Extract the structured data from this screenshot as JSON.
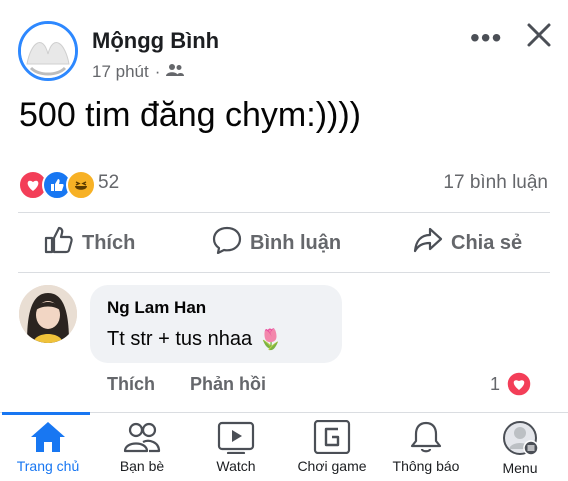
{
  "post": {
    "author": "Mộngg Bình",
    "time": "17 phút",
    "separator": "·",
    "text": "500 tim đăng chym:))))",
    "reaction_count": "52",
    "comment_count": "17 bình luận",
    "more_icon": "more-horizontal-icon",
    "close_icon": "close-icon"
  },
  "actions": {
    "like": "Thích",
    "comment": "Bình luận",
    "share": "Chia sẻ"
  },
  "comment": {
    "name": "Ng Lam Han",
    "text": "Tt str + tus nhaa",
    "emoji": "🌷",
    "like": "Thích",
    "reply": "Phản hồi",
    "reaction_count": "1"
  },
  "nav": {
    "items": [
      {
        "label": "Trang chủ",
        "icon": "home-icon",
        "active": true
      },
      {
        "label": "Bạn bè",
        "icon": "friends-icon"
      },
      {
        "label": "Watch",
        "icon": "watch-icon"
      },
      {
        "label": "Chơi game",
        "icon": "gaming-icon"
      },
      {
        "label": "Thông báo",
        "icon": "bell-icon"
      },
      {
        "label": "Menu",
        "icon": "menu-avatar-icon"
      }
    ]
  },
  "colors": {
    "accent": "#1877f2",
    "love": "#f33e58",
    "haha": "#f7b125",
    "muted": "#65676b"
  }
}
